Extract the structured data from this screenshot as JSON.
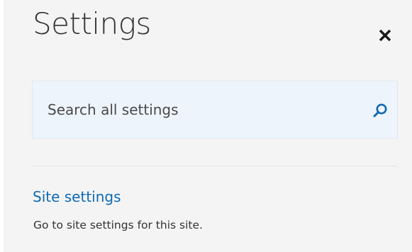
{
  "panel": {
    "title": "Settings",
    "close_icon": "close-icon"
  },
  "search": {
    "placeholder": "Search all settings",
    "value": "",
    "icon": "search-icon"
  },
  "results": [
    {
      "link_label": "Site settings",
      "description": "Go to site settings for this site."
    }
  ],
  "colors": {
    "panel_background": "#f4f4f4",
    "search_background": "#eef4fb",
    "link": "#0f6ab4",
    "accent": "#0f6ab4",
    "text": "#333333",
    "divider": "#e3e3e3"
  }
}
